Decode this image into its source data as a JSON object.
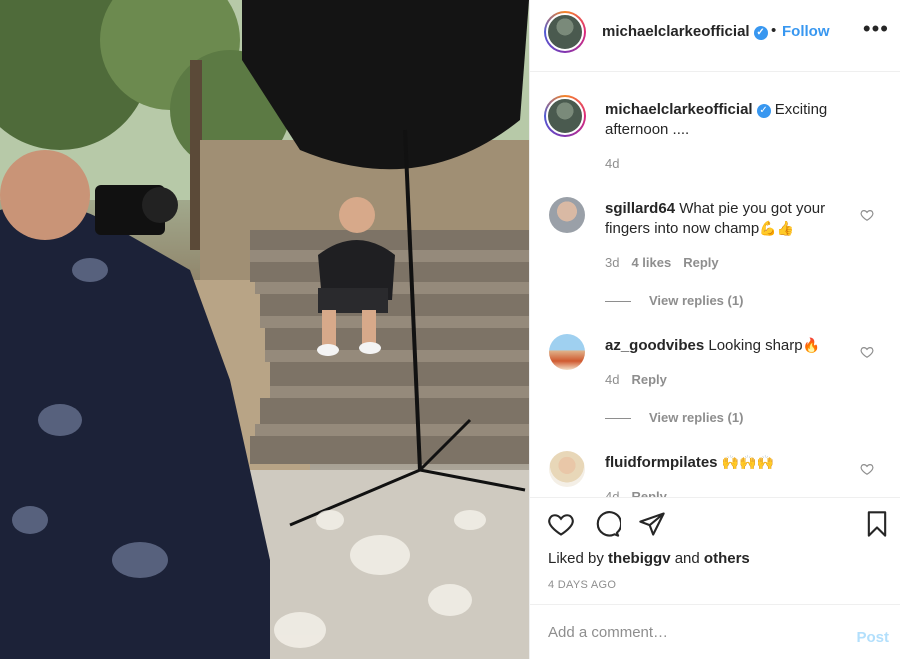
{
  "photo": {
    "alt_icon": "photo-image"
  },
  "header": {
    "username": "michaelclarkeofficial",
    "verified": "✓",
    "separator": "•",
    "follow": "Follow",
    "more": "•••"
  },
  "caption": {
    "username": "michaelclarkeofficial",
    "verified": "✓",
    "text": "Exciting afternoon ....",
    "time": "4d"
  },
  "comments": [
    {
      "username": "sgillard64",
      "text": "What pie you got your fingers into now champ",
      "emoji": "💪👍",
      "time": "3d",
      "likes": "4 likes",
      "reply": "Reply",
      "view_replies": "View replies (1)"
    },
    {
      "username": "az_goodvibes",
      "text": "Looking sharp",
      "emoji": "🔥",
      "time": "4d",
      "reply": "Reply",
      "view_replies": "View replies (1)"
    },
    {
      "username": "fluidformpilates",
      "text": "",
      "emoji": "🙌🙌🙌",
      "time": "4d",
      "reply": "Reply"
    }
  ],
  "actions": {
    "liked_prefix": "Liked by",
    "liked_user": "thebiggv",
    "liked_and": "and",
    "liked_others": "others",
    "timestamp": "4 DAYS AGO"
  },
  "add_comment": {
    "placeholder": "Add a comment…",
    "post": "Post"
  },
  "colors": {
    "link": "#3897f0",
    "muted": "#8e8e8e",
    "post_disabled": "#b2dffc",
    "border": "#efefef"
  }
}
